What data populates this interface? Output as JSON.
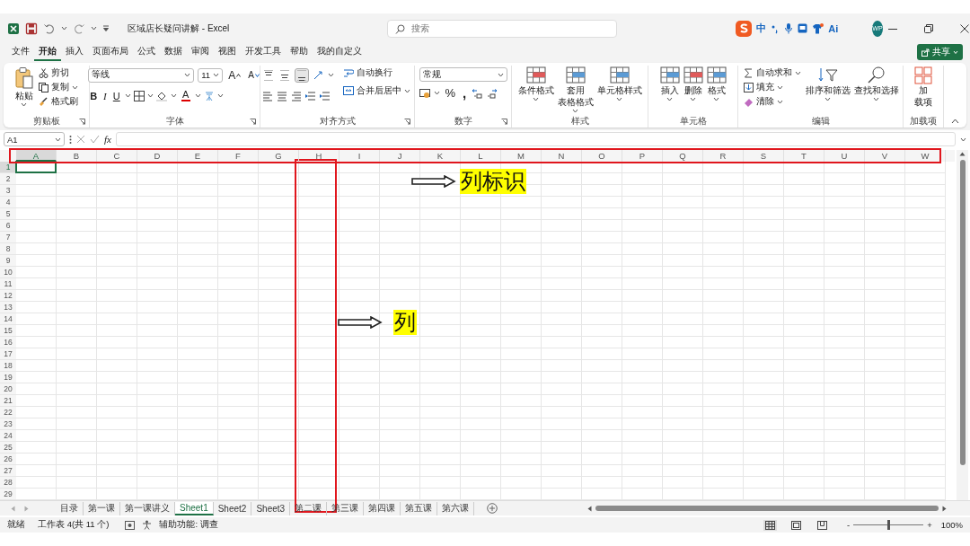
{
  "title_bar": {
    "title": "区域店长疑问讲解 - Excel",
    "search_placeholder": "搜索",
    "ime": [
      "中",
      "Ai"
    ],
    "avatar_initials": "WP"
  },
  "menu_tabs": [
    {
      "label": "文件",
      "selected": false
    },
    {
      "label": "开始",
      "selected": true
    },
    {
      "label": "插入",
      "selected": false
    },
    {
      "label": "页面布局",
      "selected": false
    },
    {
      "label": "公式",
      "selected": false
    },
    {
      "label": "数据",
      "selected": false
    },
    {
      "label": "审阅",
      "selected": false
    },
    {
      "label": "视图",
      "selected": false
    },
    {
      "label": "开发工具",
      "selected": false
    },
    {
      "label": "帮助",
      "selected": false
    },
    {
      "label": "我的自定义",
      "selected": false
    }
  ],
  "share_button": "共享",
  "ribbon": {
    "clipboard": {
      "paste": "粘贴",
      "cut": "剪切",
      "copy": "复制",
      "format_painter": "格式刷",
      "group": "剪贴板"
    },
    "font": {
      "font_name": "等线",
      "font_size": "11",
      "grow": "A",
      "shrink": "A",
      "bold": "B",
      "italic": "I",
      "underline": "U",
      "font_color": "A",
      "group": "字体"
    },
    "alignment": {
      "vertical": [
        {
          "selected": false
        },
        {
          "selected": false
        },
        {
          "selected": true
        }
      ],
      "wrap_text": "自动换行",
      "merge_center": "合并后居中",
      "group": "对齐方式"
    },
    "number": {
      "format": "常规",
      "percent": "%",
      "comma": ",",
      "group": "数字"
    },
    "styles": {
      "buttons": [
        {
          "lines": [
            "条件格式"
          ]
        },
        {
          "lines": [
            "套用",
            "表格格式"
          ]
        },
        {
          "lines": [
            "单元格样式"
          ]
        }
      ],
      "group": "样式"
    },
    "cells": {
      "buttons": [
        "插入",
        "删除",
        "格式"
      ],
      "group": "单元格"
    },
    "editing": {
      "autosum": "自动求和",
      "fill": "填充",
      "clear": "清除",
      "sort_filter": "排序和筛选",
      "find_select": "查找和选择",
      "group": "编辑"
    },
    "addins": {
      "lines": [
        "加",
        "载项"
      ],
      "group": "加载项"
    }
  },
  "formula_bar": {
    "name_box": "A1",
    "function_label": "fx"
  },
  "columns": [
    {
      "label": "A",
      "selected": true,
      "marked": false
    },
    {
      "label": "B",
      "selected": false,
      "marked": false
    },
    {
      "label": "C",
      "selected": false,
      "marked": false
    },
    {
      "label": "D",
      "selected": false,
      "marked": false
    },
    {
      "label": "E",
      "selected": false,
      "marked": false
    },
    {
      "label": "F",
      "selected": false,
      "marked": false
    },
    {
      "label": "G",
      "selected": false,
      "marked": false
    },
    {
      "label": "H",
      "selected": false,
      "marked": true
    },
    {
      "label": "I",
      "selected": false,
      "marked": false
    },
    {
      "label": "J",
      "selected": false,
      "marked": false
    },
    {
      "label": "K",
      "selected": false,
      "marked": false
    },
    {
      "label": "L",
      "selected": false,
      "marked": false
    },
    {
      "label": "M",
      "selected": false,
      "marked": false
    },
    {
      "label": "N",
      "selected": false,
      "marked": false
    },
    {
      "label": "O",
      "selected": false,
      "marked": false
    },
    {
      "label": "P",
      "selected": false,
      "marked": false
    },
    {
      "label": "Q",
      "selected": false,
      "marked": false
    },
    {
      "label": "R",
      "selected": false,
      "marked": false
    },
    {
      "label": "S",
      "selected": false,
      "marked": false
    },
    {
      "label": "T",
      "selected": false,
      "marked": false
    },
    {
      "label": "U",
      "selected": false,
      "marked": false
    },
    {
      "label": "V",
      "selected": false,
      "marked": false
    },
    {
      "label": "W",
      "selected": false,
      "marked": false
    }
  ],
  "rows": [
    {
      "label": "1",
      "selected": true
    },
    {
      "label": "2",
      "selected": false
    },
    {
      "label": "3",
      "selected": false
    },
    {
      "label": "4",
      "selected": false
    },
    {
      "label": "5",
      "selected": false
    },
    {
      "label": "6",
      "selected": false
    },
    {
      "label": "7",
      "selected": false
    },
    {
      "label": "8",
      "selected": false
    },
    {
      "label": "9",
      "selected": false
    },
    {
      "label": "10",
      "selected": false
    },
    {
      "label": "11",
      "selected": false
    },
    {
      "label": "12",
      "selected": false
    },
    {
      "label": "13",
      "selected": false
    },
    {
      "label": "14",
      "selected": false
    },
    {
      "label": "15",
      "selected": false
    },
    {
      "label": "16",
      "selected": false
    },
    {
      "label": "17",
      "selected": false
    },
    {
      "label": "18",
      "selected": false
    },
    {
      "label": "19",
      "selected": false
    },
    {
      "label": "20",
      "selected": false
    },
    {
      "label": "21",
      "selected": false
    },
    {
      "label": "22",
      "selected": false
    },
    {
      "label": "23",
      "selected": false
    },
    {
      "label": "24",
      "selected": false
    },
    {
      "label": "25",
      "selected": false
    },
    {
      "label": "26",
      "selected": false
    },
    {
      "label": "27",
      "selected": false
    },
    {
      "label": "28",
      "selected": false
    },
    {
      "label": "29",
      "selected": false
    }
  ],
  "sheet_tabs": [
    {
      "label": "目录",
      "selected": false
    },
    {
      "label": "第一课",
      "selected": false
    },
    {
      "label": "第一课讲义",
      "selected": false
    },
    {
      "label": "Sheet1",
      "selected": true
    },
    {
      "label": "Sheet2",
      "selected": false
    },
    {
      "label": "Sheet3",
      "selected": false
    },
    {
      "label": "第二课",
      "selected": false
    },
    {
      "label": "第三课",
      "selected": false
    },
    {
      "label": "第四课",
      "selected": false
    },
    {
      "label": "第五课",
      "selected": false
    },
    {
      "label": "第六课",
      "selected": false
    }
  ],
  "annotations": [
    {
      "kind": "header-callout",
      "label": "列标识"
    },
    {
      "kind": "column-callout",
      "label": "列"
    }
  ],
  "status_bar": {
    "ready": "就绪",
    "sheet_info": "工作表 4(共 11 个)",
    "accessibility": "辅助功能: 调查",
    "views": [
      {
        "selected": true
      },
      {
        "selected": false
      },
      {
        "selected": false
      }
    ],
    "zoom_minus": "-",
    "zoom_slider": {
      "level": 0.5
    },
    "zoom_plus": "+",
    "zoom_level": "100%"
  }
}
